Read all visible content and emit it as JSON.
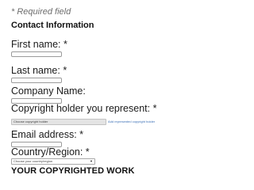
{
  "form": {
    "required_note": "* Required field",
    "section_title": "Contact Information",
    "fields": {
      "first_name": {
        "label": "First name: *",
        "value": ""
      },
      "last_name": {
        "label": "Last name: *",
        "value": ""
      },
      "company_name": {
        "label": "Company Name:",
        "value": ""
      },
      "copyright_holder": {
        "label": "Copyright holder you represent: *",
        "selected": "Choose copyright holder",
        "add_link": "Add represented copyright holder"
      },
      "email": {
        "label": "Email address: *",
        "value": ""
      },
      "country": {
        "label": "Country/Region: *",
        "selected": "Choose your country/region"
      }
    },
    "next_section_heading": "YOUR COPYRIGHTED WORK"
  },
  "icons": {
    "select_arrow": "chevron-down-icon"
  },
  "colors": {
    "link": "#3b6fb6",
    "note": "#6e6e6e"
  }
}
